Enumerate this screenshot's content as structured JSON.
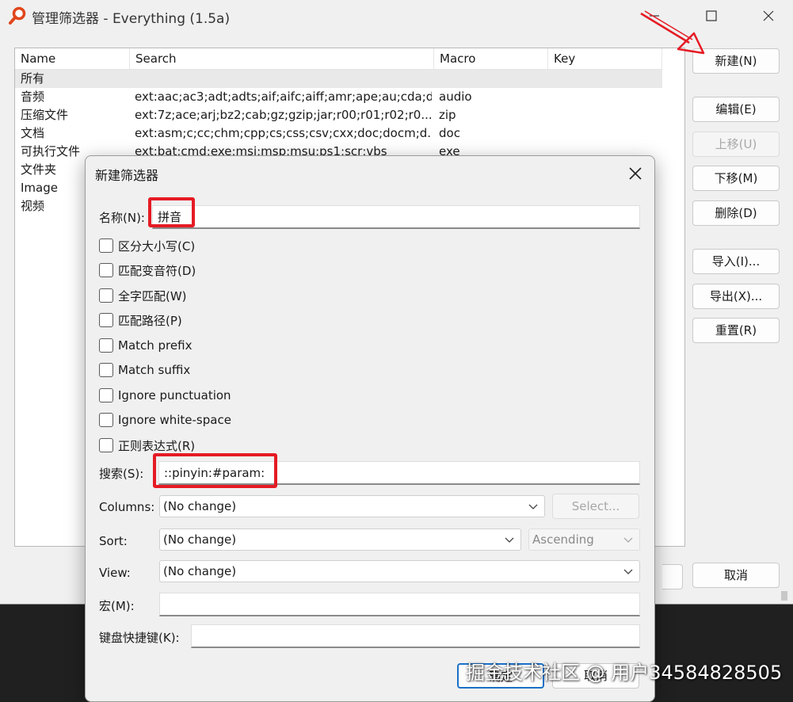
{
  "window": {
    "title": "管理筛选器 - Everything (1.5a)"
  },
  "list": {
    "columns": [
      "Name",
      "Search",
      "Macro",
      "Key"
    ],
    "rows": [
      {
        "name": "所有",
        "search": "",
        "macro": "",
        "key": ""
      },
      {
        "name": "音频",
        "search": "ext:aac;ac3;adt;adts;aif;aifc;aiff;amr;ape;au;cda;d...",
        "macro": "audio",
        "key": ""
      },
      {
        "name": "压缩文件",
        "search": "ext:7z;ace;arj;bz2;cab;gz;gzip;jar;r00;r01;r02;r0...",
        "macro": "zip",
        "key": ""
      },
      {
        "name": "文档",
        "search": "ext:asm;c;cc;chm;cpp;cs;css;csv;cxx;doc;docm;d...",
        "macro": "doc",
        "key": ""
      },
      {
        "name": "可执行文件",
        "search": "ext:bat;cmd;exe;msi;msp;msu;ps1;scr;vbs",
        "macro": "exe",
        "key": ""
      },
      {
        "name": "文件夹",
        "search": "",
        "macro": "",
        "key": ""
      },
      {
        "name": "Image",
        "search": "",
        "macro": "",
        "key": ""
      },
      {
        "name": "视频",
        "search": "",
        "macro": "",
        "key": ""
      }
    ]
  },
  "side_buttons": {
    "new": "新建(N)",
    "edit": "编辑(E)",
    "move_up": "上移(U)",
    "move_down": "下移(M)",
    "delete": "删除(D)",
    "import": "导入(I)...",
    "export": "导出(X)...",
    "reset": "重置(R)",
    "cancel": "取消"
  },
  "dialog": {
    "title": "新建筛选器",
    "name_label": "名称(N):",
    "name_value": "拼音",
    "options": [
      "区分大小写(C)",
      "匹配变音符(D)",
      "全字匹配(W)",
      "匹配路径(P)",
      "Match prefix",
      "Match suffix",
      "Ignore punctuation",
      "Ignore white-space",
      "正则表达式(R)"
    ],
    "search_label": "搜索(S):",
    "search_value": "::pinyin:#param:",
    "columns_label": "Columns:",
    "columns_value": "(No change)",
    "select_button": "Select...",
    "sort_label": "Sort:",
    "sort_value": "(No change)",
    "sort_order": "Ascending",
    "view_label": "View:",
    "view_value": "(No change)",
    "macro_label": "宏(M):",
    "macro_value": "",
    "hotkey_label": "键盘快捷键(K):",
    "hotkey_value": "",
    "ok_button": "确定",
    "cancel_button": "取消"
  },
  "watermark": "掘金技术社区 @ 用户34584828505",
  "colors": {
    "highlight": "#e51b24",
    "accent": "#1a6fc7"
  }
}
